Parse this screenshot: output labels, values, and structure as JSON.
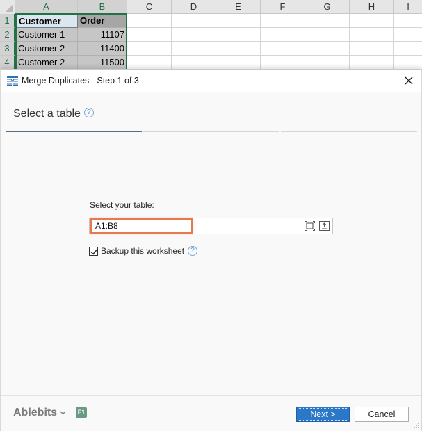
{
  "spreadsheet": {
    "columns": [
      "A",
      "B",
      "C",
      "D",
      "E",
      "F",
      "G",
      "H",
      "I"
    ],
    "rows": [
      {
        "num": "1",
        "a": "Customer",
        "b": "Order"
      },
      {
        "num": "2",
        "a": "Customer 1",
        "b": "11107"
      },
      {
        "num": "3",
        "a": "Customer 2",
        "b": "11400"
      },
      {
        "num": "4",
        "a": "Customer 2",
        "b": "11500"
      }
    ]
  },
  "dialog": {
    "title": "Merge Duplicates - Step 1 of 3",
    "title_icon": "table-merge-icon",
    "close_icon": "close-icon",
    "step_title": "Select a table",
    "help_glyph": "?",
    "progress": {
      "current_step": 1,
      "total_steps": 3
    },
    "field_label": "Select your table:",
    "range_value": "A1:B8",
    "expand_icon": "expand-selection-icon",
    "collapse_icon": "collapse-dialog-icon",
    "backup_label": "Backup this worksheet",
    "backup_checked": true
  },
  "footer": {
    "brand": "Ablebits",
    "f1_badge": "F1",
    "next_label": "Next >",
    "cancel_label": "Cancel"
  },
  "colors": {
    "accent": "#2b78c8",
    "excel_green": "#217346",
    "highlight_orange": "#e57b4d",
    "f1_badge": "#6a9a84"
  }
}
